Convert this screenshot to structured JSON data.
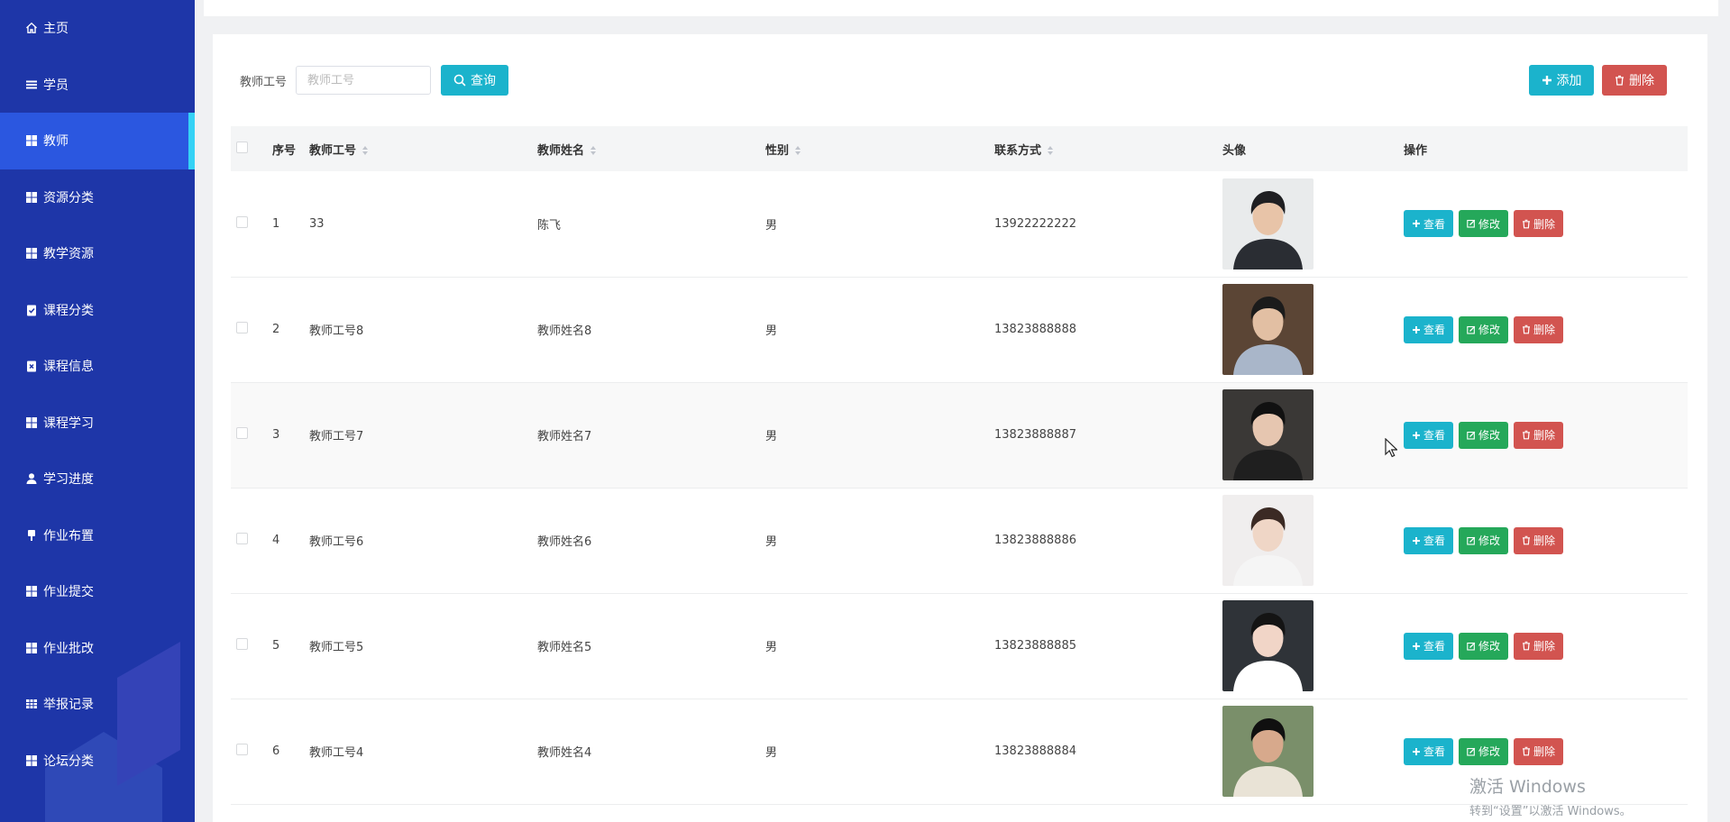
{
  "sidebar": {
    "items": [
      {
        "label": "主页",
        "icon": "home-icon",
        "active": false
      },
      {
        "label": "学员",
        "icon": "list-icon",
        "active": false
      },
      {
        "label": "教师",
        "icon": "grid-icon",
        "active": true
      },
      {
        "label": "资源分类",
        "icon": "grid-icon",
        "active": false
      },
      {
        "label": "教学资源",
        "icon": "grid-icon",
        "active": false
      },
      {
        "label": "课程分类",
        "icon": "clipboard-check-icon",
        "active": false
      },
      {
        "label": "课程信息",
        "icon": "clipboard-x-icon",
        "active": false
      },
      {
        "label": "课程学习",
        "icon": "grid-icon",
        "active": false
      },
      {
        "label": "学习进度",
        "icon": "user-icon",
        "active": false
      },
      {
        "label": "作业布置",
        "icon": "pin-icon",
        "active": false
      },
      {
        "label": "作业提交",
        "icon": "grid-icon",
        "active": false
      },
      {
        "label": "作业批改",
        "icon": "grid-icon",
        "active": false
      },
      {
        "label": "举报记录",
        "icon": "table-icon",
        "active": false
      },
      {
        "label": "论坛分类",
        "icon": "grid-icon",
        "active": false
      }
    ]
  },
  "search": {
    "label": "教师工号",
    "placeholder": "教师工号",
    "value": "",
    "query_label": "查询"
  },
  "toolbar": {
    "add_label": "添加",
    "delete_label": "删除"
  },
  "table": {
    "columns": {
      "index": "序号",
      "teacher_id": "教师工号",
      "teacher_name": "教师姓名",
      "gender": "性别",
      "contact": "联系方式",
      "avatar": "头像",
      "actions": "操作"
    },
    "row_actions": {
      "view": "查看",
      "edit": "修改",
      "delete": "删除"
    },
    "rows": [
      {
        "index": "1",
        "teacher_id": "33",
        "teacher_name": "陈飞",
        "gender": "男",
        "contact": "13922222222"
      },
      {
        "index": "2",
        "teacher_id": "教师工号8",
        "teacher_name": "教师姓名8",
        "gender": "男",
        "contact": "13823888888"
      },
      {
        "index": "3",
        "teacher_id": "教师工号7",
        "teacher_name": "教师姓名7",
        "gender": "男",
        "contact": "13823888887"
      },
      {
        "index": "4",
        "teacher_id": "教师工号6",
        "teacher_name": "教师姓名6",
        "gender": "男",
        "contact": "13823888886"
      },
      {
        "index": "5",
        "teacher_id": "教师工号5",
        "teacher_name": "教师姓名5",
        "gender": "男",
        "contact": "13823888885"
      },
      {
        "index": "6",
        "teacher_id": "教师工号4",
        "teacher_name": "教师姓名4",
        "gender": "男",
        "contact": "13823888884"
      }
    ]
  },
  "watermark": {
    "line1": "激活 Windows",
    "line2": "转到“设置”以激活 Windows。"
  },
  "colors": {
    "sidebar_bg": "#1e36a8",
    "sidebar_active": "#2b57e0",
    "accent_cyan": "#1bb3cc",
    "edit_green": "#25a85a",
    "danger_red": "#d25450"
  }
}
